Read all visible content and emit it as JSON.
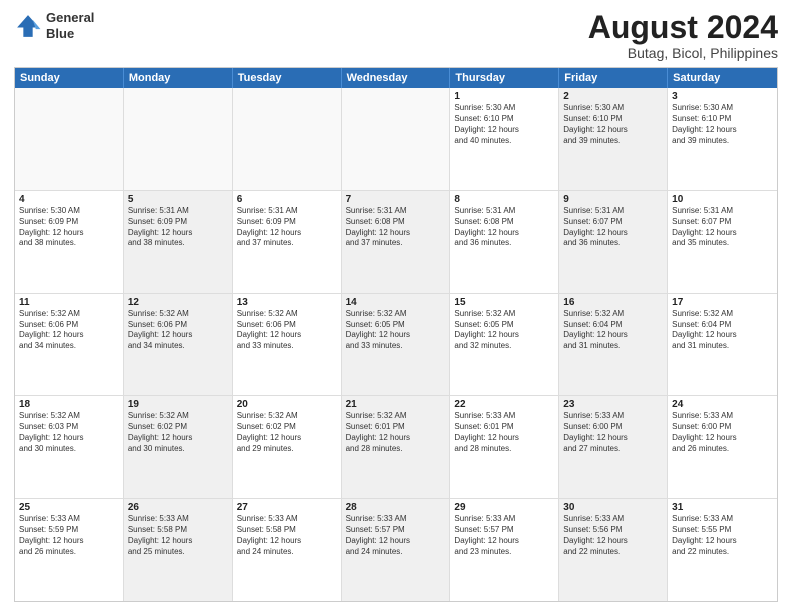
{
  "header": {
    "logo_line1": "General",
    "logo_line2": "Blue",
    "title": "August 2024",
    "subtitle": "Butag, Bicol, Philippines"
  },
  "weekdays": [
    "Sunday",
    "Monday",
    "Tuesday",
    "Wednesday",
    "Thursday",
    "Friday",
    "Saturday"
  ],
  "rows": [
    [
      {
        "day": "",
        "info": "",
        "shaded": false,
        "empty": true
      },
      {
        "day": "",
        "info": "",
        "shaded": false,
        "empty": true
      },
      {
        "day": "",
        "info": "",
        "shaded": false,
        "empty": true
      },
      {
        "day": "",
        "info": "",
        "shaded": false,
        "empty": true
      },
      {
        "day": "1",
        "info": "Sunrise: 5:30 AM\nSunset: 6:10 PM\nDaylight: 12 hours\nand 40 minutes.",
        "shaded": false,
        "empty": false
      },
      {
        "day": "2",
        "info": "Sunrise: 5:30 AM\nSunset: 6:10 PM\nDaylight: 12 hours\nand 39 minutes.",
        "shaded": true,
        "empty": false
      },
      {
        "day": "3",
        "info": "Sunrise: 5:30 AM\nSunset: 6:10 PM\nDaylight: 12 hours\nand 39 minutes.",
        "shaded": false,
        "empty": false
      }
    ],
    [
      {
        "day": "4",
        "info": "Sunrise: 5:30 AM\nSunset: 6:09 PM\nDaylight: 12 hours\nand 38 minutes.",
        "shaded": false,
        "empty": false
      },
      {
        "day": "5",
        "info": "Sunrise: 5:31 AM\nSunset: 6:09 PM\nDaylight: 12 hours\nand 38 minutes.",
        "shaded": true,
        "empty": false
      },
      {
        "day": "6",
        "info": "Sunrise: 5:31 AM\nSunset: 6:09 PM\nDaylight: 12 hours\nand 37 minutes.",
        "shaded": false,
        "empty": false
      },
      {
        "day": "7",
        "info": "Sunrise: 5:31 AM\nSunset: 6:08 PM\nDaylight: 12 hours\nand 37 minutes.",
        "shaded": true,
        "empty": false
      },
      {
        "day": "8",
        "info": "Sunrise: 5:31 AM\nSunset: 6:08 PM\nDaylight: 12 hours\nand 36 minutes.",
        "shaded": false,
        "empty": false
      },
      {
        "day": "9",
        "info": "Sunrise: 5:31 AM\nSunset: 6:07 PM\nDaylight: 12 hours\nand 36 minutes.",
        "shaded": true,
        "empty": false
      },
      {
        "day": "10",
        "info": "Sunrise: 5:31 AM\nSunset: 6:07 PM\nDaylight: 12 hours\nand 35 minutes.",
        "shaded": false,
        "empty": false
      }
    ],
    [
      {
        "day": "11",
        "info": "Sunrise: 5:32 AM\nSunset: 6:06 PM\nDaylight: 12 hours\nand 34 minutes.",
        "shaded": false,
        "empty": false
      },
      {
        "day": "12",
        "info": "Sunrise: 5:32 AM\nSunset: 6:06 PM\nDaylight: 12 hours\nand 34 minutes.",
        "shaded": true,
        "empty": false
      },
      {
        "day": "13",
        "info": "Sunrise: 5:32 AM\nSunset: 6:06 PM\nDaylight: 12 hours\nand 33 minutes.",
        "shaded": false,
        "empty": false
      },
      {
        "day": "14",
        "info": "Sunrise: 5:32 AM\nSunset: 6:05 PM\nDaylight: 12 hours\nand 33 minutes.",
        "shaded": true,
        "empty": false
      },
      {
        "day": "15",
        "info": "Sunrise: 5:32 AM\nSunset: 6:05 PM\nDaylight: 12 hours\nand 32 minutes.",
        "shaded": false,
        "empty": false
      },
      {
        "day": "16",
        "info": "Sunrise: 5:32 AM\nSunset: 6:04 PM\nDaylight: 12 hours\nand 31 minutes.",
        "shaded": true,
        "empty": false
      },
      {
        "day": "17",
        "info": "Sunrise: 5:32 AM\nSunset: 6:04 PM\nDaylight: 12 hours\nand 31 minutes.",
        "shaded": false,
        "empty": false
      }
    ],
    [
      {
        "day": "18",
        "info": "Sunrise: 5:32 AM\nSunset: 6:03 PM\nDaylight: 12 hours\nand 30 minutes.",
        "shaded": false,
        "empty": false
      },
      {
        "day": "19",
        "info": "Sunrise: 5:32 AM\nSunset: 6:02 PM\nDaylight: 12 hours\nand 30 minutes.",
        "shaded": true,
        "empty": false
      },
      {
        "day": "20",
        "info": "Sunrise: 5:32 AM\nSunset: 6:02 PM\nDaylight: 12 hours\nand 29 minutes.",
        "shaded": false,
        "empty": false
      },
      {
        "day": "21",
        "info": "Sunrise: 5:32 AM\nSunset: 6:01 PM\nDaylight: 12 hours\nand 28 minutes.",
        "shaded": true,
        "empty": false
      },
      {
        "day": "22",
        "info": "Sunrise: 5:33 AM\nSunset: 6:01 PM\nDaylight: 12 hours\nand 28 minutes.",
        "shaded": false,
        "empty": false
      },
      {
        "day": "23",
        "info": "Sunrise: 5:33 AM\nSunset: 6:00 PM\nDaylight: 12 hours\nand 27 minutes.",
        "shaded": true,
        "empty": false
      },
      {
        "day": "24",
        "info": "Sunrise: 5:33 AM\nSunset: 6:00 PM\nDaylight: 12 hours\nand 26 minutes.",
        "shaded": false,
        "empty": false
      }
    ],
    [
      {
        "day": "25",
        "info": "Sunrise: 5:33 AM\nSunset: 5:59 PM\nDaylight: 12 hours\nand 26 minutes.",
        "shaded": false,
        "empty": false
      },
      {
        "day": "26",
        "info": "Sunrise: 5:33 AM\nSunset: 5:58 PM\nDaylight: 12 hours\nand 25 minutes.",
        "shaded": true,
        "empty": false
      },
      {
        "day": "27",
        "info": "Sunrise: 5:33 AM\nSunset: 5:58 PM\nDaylight: 12 hours\nand 24 minutes.",
        "shaded": false,
        "empty": false
      },
      {
        "day": "28",
        "info": "Sunrise: 5:33 AM\nSunset: 5:57 PM\nDaylight: 12 hours\nand 24 minutes.",
        "shaded": true,
        "empty": false
      },
      {
        "day": "29",
        "info": "Sunrise: 5:33 AM\nSunset: 5:57 PM\nDaylight: 12 hours\nand 23 minutes.",
        "shaded": false,
        "empty": false
      },
      {
        "day": "30",
        "info": "Sunrise: 5:33 AM\nSunset: 5:56 PM\nDaylight: 12 hours\nand 22 minutes.",
        "shaded": true,
        "empty": false
      },
      {
        "day": "31",
        "info": "Sunrise: 5:33 AM\nSunset: 5:55 PM\nDaylight: 12 hours\nand 22 minutes.",
        "shaded": false,
        "empty": false
      }
    ]
  ]
}
